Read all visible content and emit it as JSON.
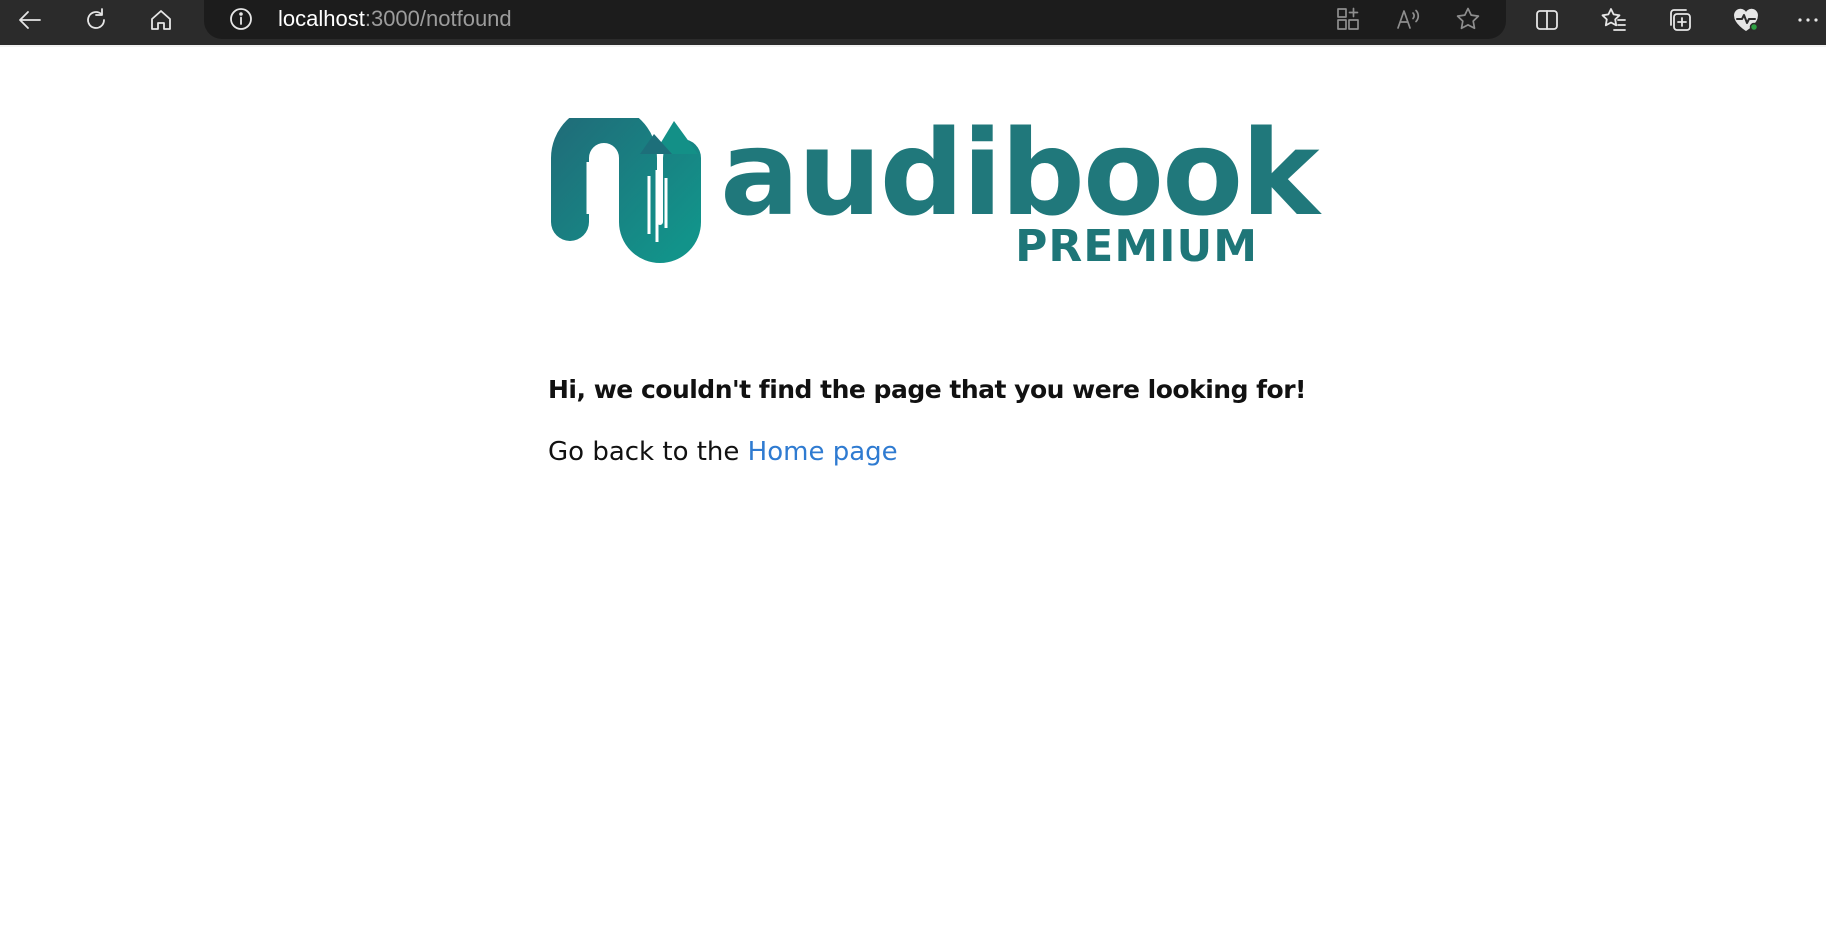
{
  "browser": {
    "address": {
      "host": "localhost",
      "path": ":3000/notfound"
    },
    "icons": {
      "back": "back-arrow-icon",
      "refresh": "refresh-icon",
      "home": "home-icon",
      "site_info": "info-icon",
      "apps": "apps-icon",
      "read_aloud": "read-aloud-icon",
      "favorite": "star-icon",
      "split_screen": "split-screen-icon",
      "favorites": "favorites-list-icon",
      "collections": "collections-icon",
      "browser_essentials": "heartbeat-icon",
      "more": "more-icon"
    }
  },
  "page": {
    "logo": {
      "wordmark": "audibook",
      "subtitle": "PREMIUM"
    },
    "message": "Hi, we couldn't find the page that you were looking for!",
    "back_prefix": "Go back to the ",
    "home_link": "Home page"
  },
  "colors": {
    "brand_teal": "#20787b",
    "brand_teal_light": "#148a80",
    "link": "#2f7bd1",
    "toolbar_bg": "#2b2b2b",
    "address_bg": "#1c1c1c"
  }
}
